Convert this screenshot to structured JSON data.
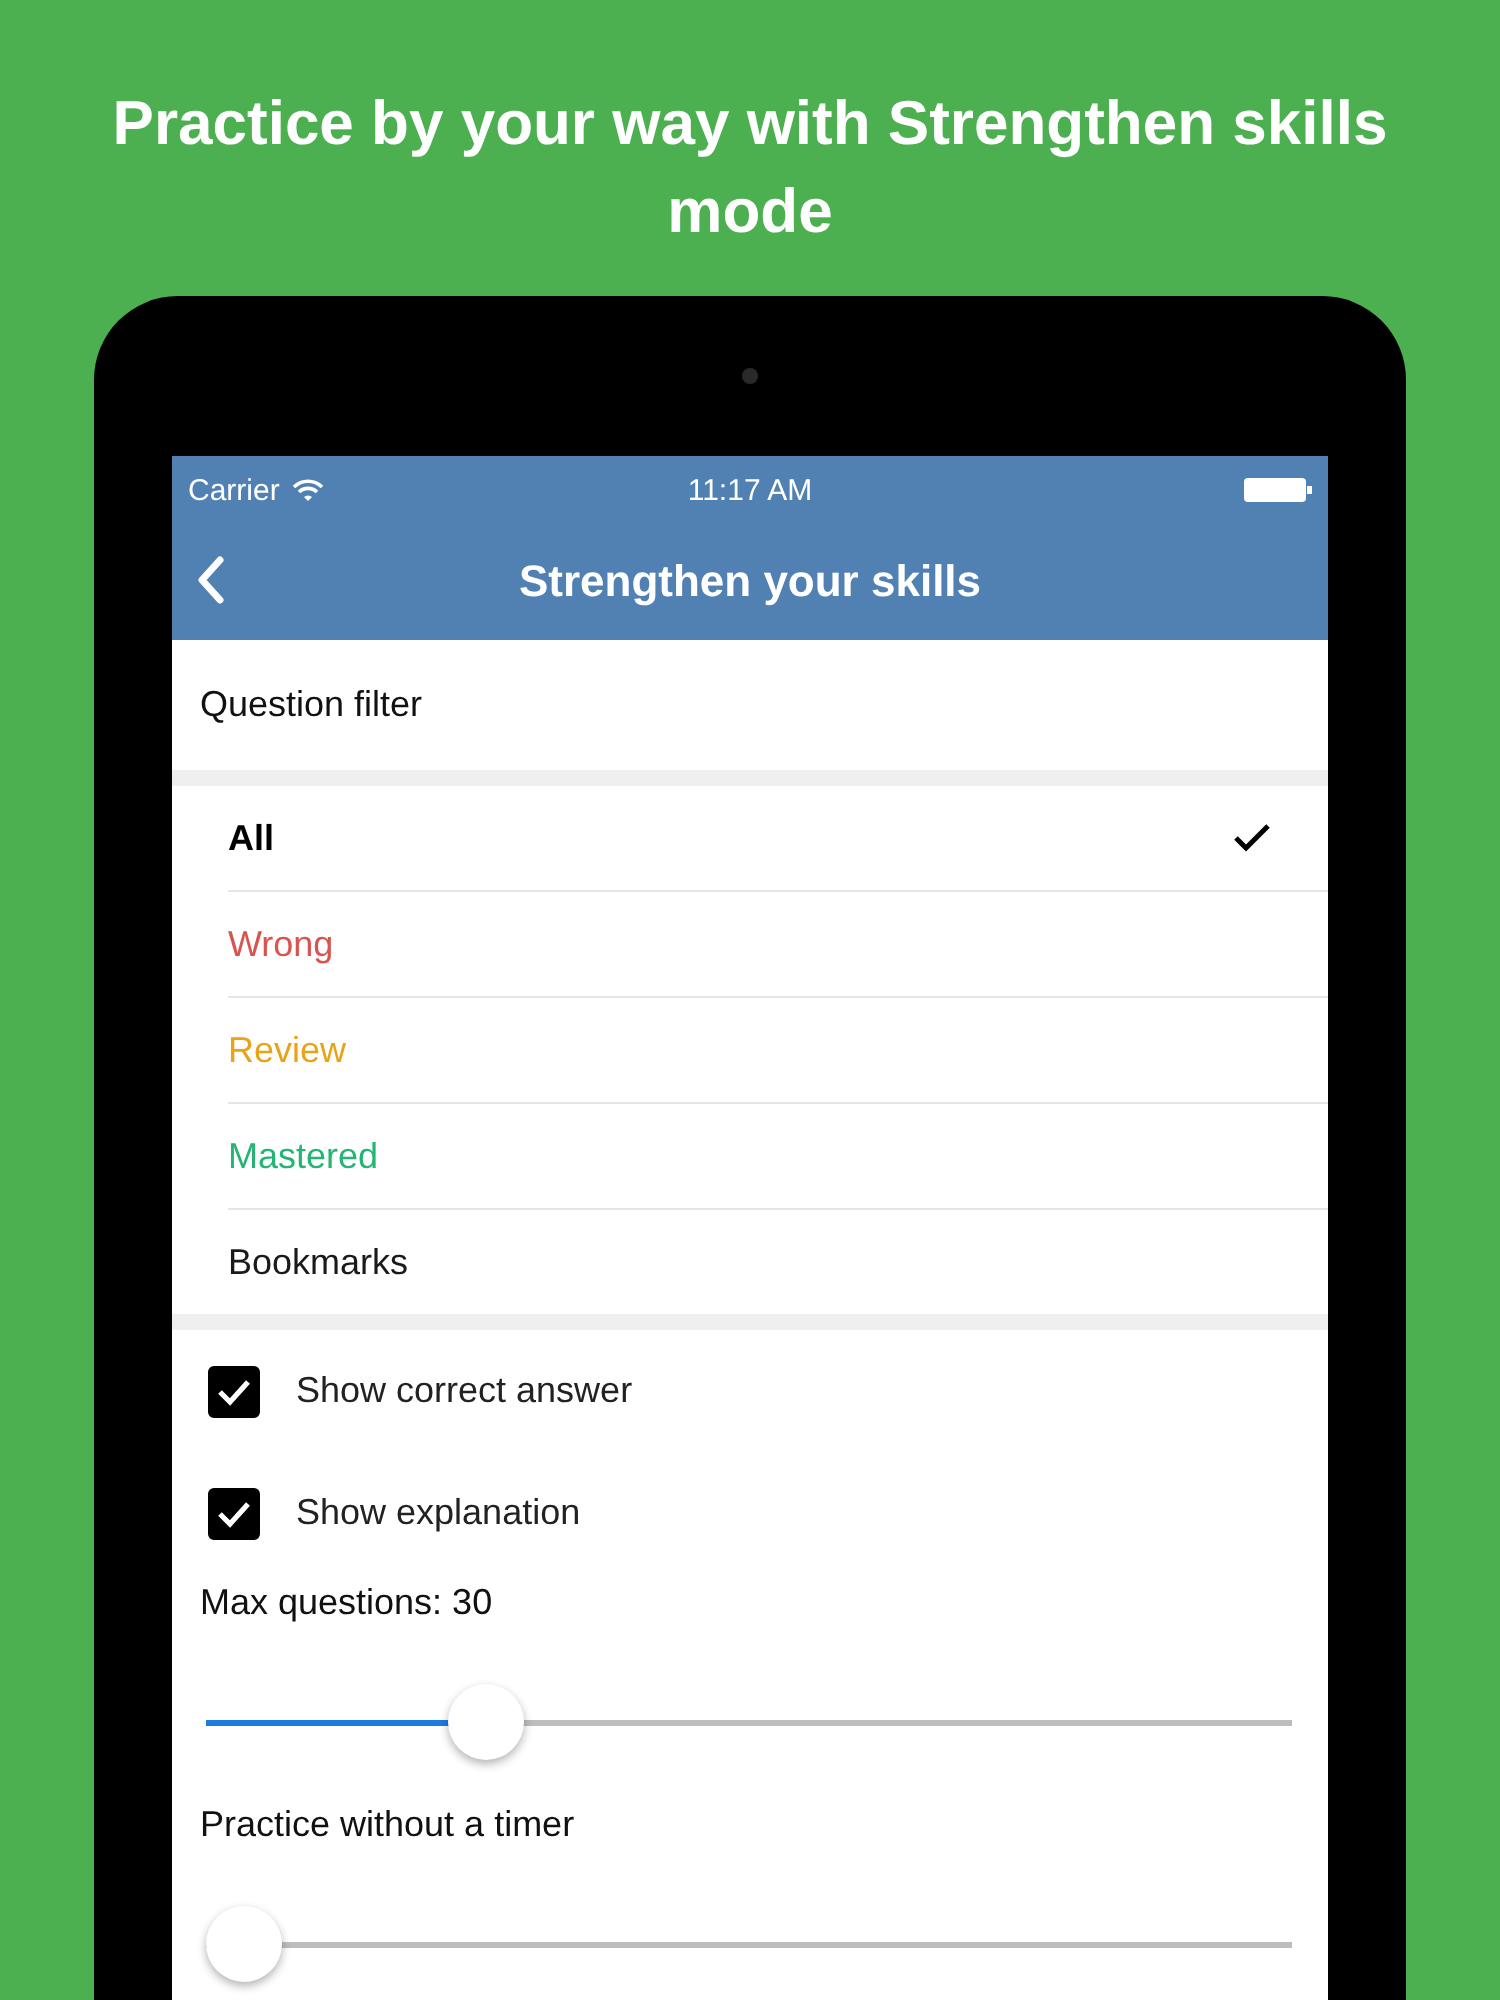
{
  "headline": "Practice by your way with Strengthen skills mode",
  "status_bar": {
    "carrier": "Carrier",
    "time": "11:17 AM"
  },
  "nav": {
    "title": "Strengthen your skills"
  },
  "filter": {
    "heading": "Question filter",
    "items": [
      {
        "label": "All",
        "color": "#000000",
        "selected": true
      },
      {
        "label": "Wrong",
        "color": "#d9534f",
        "selected": false
      },
      {
        "label": "Review",
        "color": "#e8a317",
        "selected": false
      },
      {
        "label": "Mastered",
        "color": "#22b573",
        "selected": false
      },
      {
        "label": "Bookmarks",
        "color": "#1a1a1a",
        "selected": false
      }
    ]
  },
  "options": [
    {
      "label": "Show correct answer",
      "checked": true
    },
    {
      "label": "Show explanation",
      "checked": true
    }
  ],
  "sliders": [
    {
      "label": "Max questions: 30",
      "level": 0.24
    },
    {
      "label": "Practice without a timer",
      "level": 0
    }
  ]
}
